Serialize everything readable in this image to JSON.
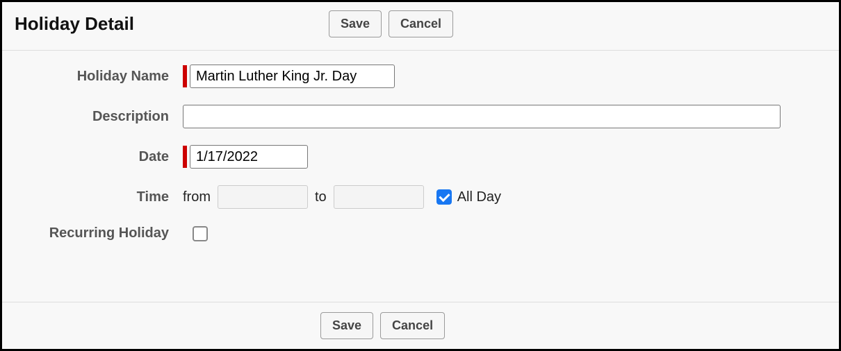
{
  "header": {
    "title": "Holiday Detail",
    "save_label": "Save",
    "cancel_label": "Cancel"
  },
  "form": {
    "holiday_name_label": "Holiday Name",
    "holiday_name_value": "Martin Luther King Jr. Day",
    "description_label": "Description",
    "description_value": "",
    "date_label": "Date",
    "date_value": "1/17/2022",
    "time_label": "Time",
    "time_from_label": "from",
    "time_from_value": "",
    "time_to_label": "to",
    "time_to_value": "",
    "all_day_label": "All Day",
    "all_day_checked": true,
    "recurring_label": "Recurring Holiday",
    "recurring_checked": false
  },
  "footer": {
    "save_label": "Save",
    "cancel_label": "Cancel"
  }
}
